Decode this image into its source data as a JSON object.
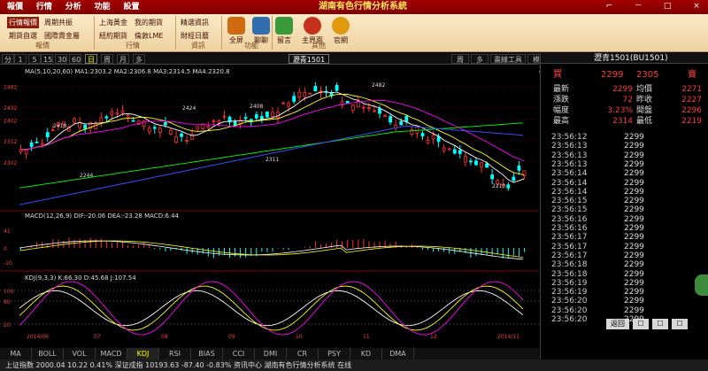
{
  "menubar": {
    "items": [
      "報價",
      "行情",
      "分析",
      "功能",
      "設置"
    ]
  },
  "app_title": "湖南有色行情分析系統",
  "window_controls": [
    "⌐",
    "－",
    "□",
    "×"
  ],
  "toolbar": {
    "quote_group": {
      "buttons": [
        "行情報價",
        "周期共振",
        "期貨自選",
        "國際貴金屬",
        "上海黃金",
        "我的期貨",
        "紐約期貨",
        "倫敦LME",
        "精選資訊",
        "財經日曆"
      ],
      "selected": "行情報價",
      "labels": [
        "報價",
        "行情",
        "資訊"
      ]
    },
    "big_buttons": [
      {
        "label": "全屏"
      },
      {
        "label": "聊聊"
      },
      {
        "label": "留言"
      },
      {
        "label": "主界面"
      },
      {
        "label": "官網"
      }
    ],
    "big_labels": [
      "功能",
      "其他"
    ]
  },
  "periods": {
    "items": [
      "分",
      "1",
      "5",
      "15",
      "30",
      "60",
      "日",
      "周",
      "月",
      "多"
    ],
    "selected": "日",
    "symbol": "瀝青1501",
    "right_buttons": [
      "周期",
      "多空",
      "畫線工具",
      "模式"
    ]
  },
  "chart": {
    "ma_legend": "MA(5,10,20,60) MA1:2303.2  MA2:2306.8  MA3:2314.5  MA4:2320.8",
    "price_labels": [
      "2482",
      "2432",
      "2402",
      "2352",
      "2302"
    ],
    "annotations": [
      {
        "text": "2482"
      },
      {
        "text": "2424"
      },
      {
        "text": "2408"
      },
      {
        "text": "2418"
      },
      {
        "text": "2244"
      },
      {
        "text": "2311"
      },
      {
        "text": "2210"
      }
    ],
    "macd_legend": "MACD(12,26,9) DIF:-20.06 DEA:-23.28 MACD:6.44",
    "macd_labels": [
      "41",
      "0",
      "-10"
    ],
    "kdj_legend": "KDJ(9,3,3) K:66.30 D:45.68 J:107.54",
    "kdj_labels": [
      "100",
      "80",
      "20"
    ],
    "x_labels": [
      "2014/06",
      "07",
      "08",
      "09",
      "10",
      "11",
      "12",
      "2014/11"
    ]
  },
  "chart_data": {
    "type": "candlestick",
    "title": "瀝青1501",
    "ma_colors": [
      "#ffffff",
      "#ffff00",
      "#ff00ff",
      "#00ff00"
    ],
    "price_range": [
      2190,
      2510
    ]
  },
  "indicator_tabs": {
    "items": [
      "MA",
      "BOLL",
      "VOL",
      "MACD",
      "KDJ",
      "RSI",
      "BIAS",
      "CCI",
      "DMI",
      "CR",
      "PSY",
      "KD",
      "DMA"
    ],
    "selected": "KDJ"
  },
  "status": {
    "text": "上证指数 2000.04 10.22 0.41%  深证成指 10193.63 -87.40 -0.83%  资讯中心  湖南有色行情分析系统  在线"
  },
  "quote": {
    "title": "瀝青1501(BU1501)",
    "buy_label": "買",
    "buy_price": "2299",
    "sell_price": "2305",
    "sell_label": "賣",
    "rows": [
      {
        "l1": "最新",
        "v1": "2299",
        "l2": "均價",
        "v2": "2271"
      },
      {
        "l1": "漲跌",
        "v1": "72",
        "l2": "昨收",
        "v2": "2227"
      },
      {
        "l1": "幅度",
        "v1": "3.23%",
        "l2": "開盤",
        "v2": "2296"
      },
      {
        "l1": "最高",
        "v1": "2314",
        "l2": "最低",
        "v2": "2219"
      }
    ]
  },
  "ticks": [
    {
      "time": "23:56:12",
      "price": "2299"
    },
    {
      "time": "23:56:13",
      "price": "2299"
    },
    {
      "time": "23:56:13",
      "price": "2299"
    },
    {
      "time": "23:56:13",
      "price": "2299"
    },
    {
      "time": "23:56:14",
      "price": "2299"
    },
    {
      "time": "23:56:14",
      "price": "2299"
    },
    {
      "time": "23:56:14",
      "price": "2299"
    },
    {
      "time": "23:56:15",
      "price": "2299"
    },
    {
      "time": "23:56:15",
      "price": "2299"
    },
    {
      "time": "23:56:16",
      "price": "2299"
    },
    {
      "time": "23:56:16",
      "price": "2299"
    },
    {
      "time": "23:56:17",
      "price": "2299"
    },
    {
      "time": "23:56:17",
      "price": "2299"
    },
    {
      "time": "23:56:17",
      "price": "2299"
    },
    {
      "time": "23:56:18",
      "price": "2299"
    },
    {
      "time": "23:56:18",
      "price": "2299"
    },
    {
      "time": "23:56:19",
      "price": "2299"
    },
    {
      "time": "23:56:19",
      "price": "2299"
    },
    {
      "time": "23:56:20",
      "price": "2299"
    },
    {
      "time": "23:56:20",
      "price": "2299"
    },
    {
      "time": "23:56:20",
      "price": "2299"
    }
  ],
  "rp_bottom_buttons": [
    "返回",
    "☐",
    "☐",
    "☐"
  ],
  "colors": {
    "up": "#ff3030",
    "down": "#00ffff",
    "accent": "#b00000",
    "quote_red": "#ff3b3b"
  }
}
